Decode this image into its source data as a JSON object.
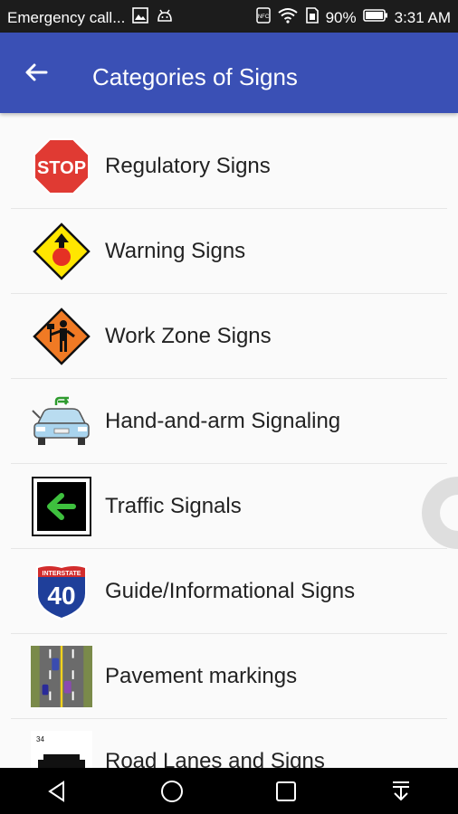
{
  "status_bar": {
    "notification_text": "Emergency call...",
    "battery": "90%",
    "time": "3:31 AM",
    "icons": [
      "gallery-icon",
      "android-icon",
      "nfc-icon",
      "wifi-icon",
      "sim-icon",
      "battery-icon"
    ]
  },
  "app_bar": {
    "title": "Categories of Signs",
    "back_icon": "arrow-left-icon"
  },
  "categories": [
    {
      "label": "Regulatory Signs",
      "icon": "stop-sign-icon"
    },
    {
      "label": "Warning Signs",
      "icon": "warning-sign-icon"
    },
    {
      "label": "Work Zone Signs",
      "icon": "work-zone-sign-icon"
    },
    {
      "label": "Hand-and-arm Signaling",
      "icon": "car-signal-icon"
    },
    {
      "label": "Traffic Signals",
      "icon": "green-arrow-signal-icon"
    },
    {
      "label": "Guide/Informational Signs",
      "icon": "interstate-40-icon"
    },
    {
      "label": "Pavement markings",
      "icon": "road-markings-icon"
    },
    {
      "label": "Road Lanes and Signs",
      "icon": "partial-sign-icon"
    }
  ],
  "nav_bar": {
    "buttons": [
      "back-icon",
      "home-icon",
      "recents-icon",
      "notification-pull-icon"
    ]
  }
}
